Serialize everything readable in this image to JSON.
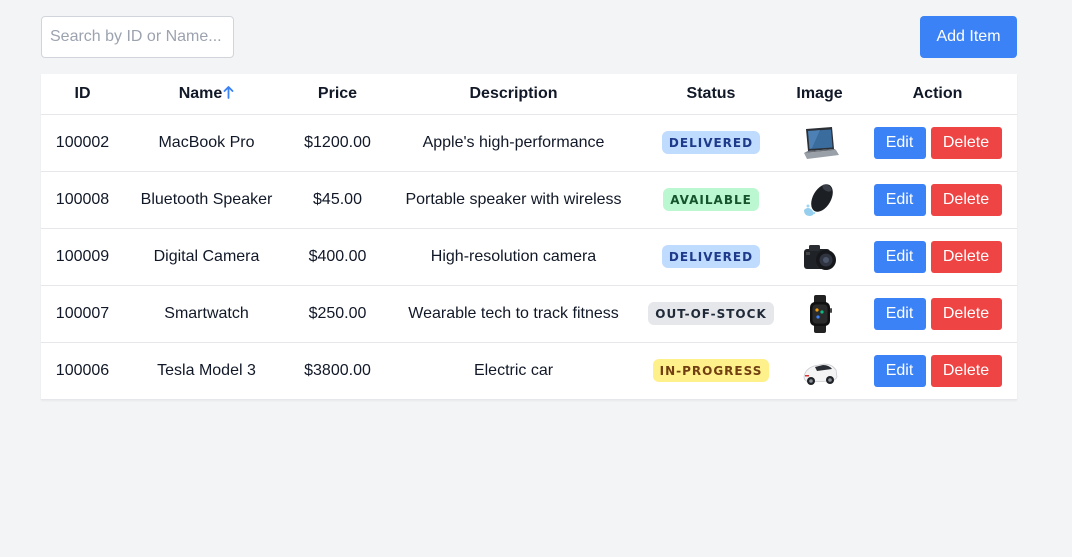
{
  "toolbar": {
    "search_placeholder": "Search by ID or Name...",
    "search_value": "",
    "add_label": "Add Item",
    "accent_color": "#3b82f6"
  },
  "table": {
    "headers": {
      "id": "ID",
      "name": "Name",
      "name_sort_icon": "arrow-up-icon",
      "price": "Price",
      "description": "Description",
      "status": "Status",
      "image": "Image",
      "action": "Action"
    },
    "edit_label": "Edit",
    "delete_label": "Delete",
    "edit_color": "#3b82f6",
    "delete_color": "#ef4444",
    "status_styles": {
      "DELIVERED": {
        "bg": "#bfdbfe",
        "fg": "#1e3a8a"
      },
      "AVAILABLE": {
        "bg": "#bbf7d0",
        "fg": "#14532d"
      },
      "OUT-OF-STOCK": {
        "bg": "#e5e7eb",
        "fg": "#1f2937"
      },
      "IN-PROGRESS": {
        "bg": "#fef08a",
        "fg": "#713f12"
      }
    },
    "rows": [
      {
        "id": "100002",
        "name": "MacBook Pro",
        "price": "$1200.00",
        "description": "Apple's high-performance",
        "status": "DELIVERED",
        "image": "laptop-image"
      },
      {
        "id": "100008",
        "name": "Bluetooth Speaker",
        "price": "$45.00",
        "description": "Portable speaker with wireless",
        "status": "AVAILABLE",
        "image": "speaker-image"
      },
      {
        "id": "100009",
        "name": "Digital Camera",
        "price": "$400.00",
        "description": "High-resolution camera",
        "status": "DELIVERED",
        "image": "camera-image"
      },
      {
        "id": "100007",
        "name": "Smartwatch",
        "price": "$250.00",
        "description": "Wearable tech to track fitness",
        "status": "OUT-OF-STOCK",
        "image": "smartwatch-image"
      },
      {
        "id": "100006",
        "name": "Tesla Model 3",
        "price": "$3800.00",
        "description": "Electric car",
        "status": "IN-PROGRESS",
        "image": "car-image"
      }
    ]
  }
}
